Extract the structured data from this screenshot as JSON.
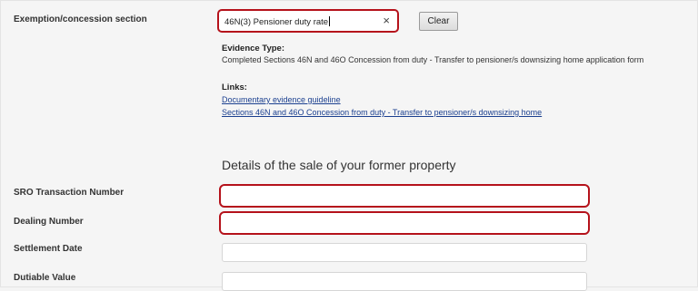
{
  "exemption": {
    "label": "Exemption/concession section",
    "selected_value": "46N(3) Pensioner duty rate",
    "clear_symbol": "×",
    "clear_button": "Clear"
  },
  "evidence": {
    "title": "Evidence Type:",
    "text": "Completed Sections 46N and 46O Concession from duty - Transfer to pensioner/s downsizing home application form"
  },
  "links": {
    "title": "Links:",
    "items": [
      "Documentary evidence guideline",
      "Sections 46N and 46O Concession from duty - Transfer to pensioner/s downsizing home"
    ]
  },
  "sale_section": {
    "heading": "Details of the sale of your former property"
  },
  "fields": [
    {
      "label": "SRO Transaction Number",
      "value": ""
    },
    {
      "label": "Dealing Number",
      "value": ""
    },
    {
      "label": "Settlement Date",
      "value": ""
    },
    {
      "label": "Dutiable Value",
      "value": ""
    }
  ],
  "colors": {
    "highlight": "#b5121b",
    "link": "#1a3f8f"
  }
}
